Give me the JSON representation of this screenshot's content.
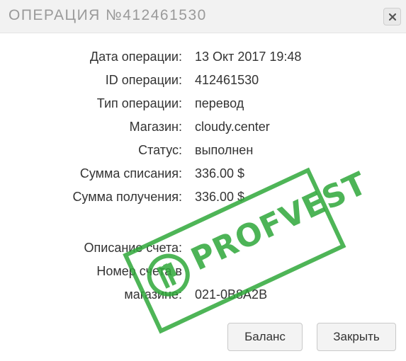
{
  "dialog": {
    "title": "ОПЕРАЦИЯ №412461530",
    "close_icon": "close-x-icon"
  },
  "details": [
    {
      "label": "Дата операции:",
      "value": "13 Окт 2017 19:48"
    },
    {
      "label": "ID операции:",
      "value": "412461530"
    },
    {
      "label": "Тип операции:",
      "value": "перевод"
    },
    {
      "label": "Магазин:",
      "value": "cloudy.center"
    },
    {
      "label": "Статус:",
      "value": "выполнен"
    },
    {
      "label": "Сумма списания:",
      "value": "336.00 $"
    },
    {
      "label": "Сумма получения:",
      "value": "336.00 $"
    }
  ],
  "extra": [
    {
      "label": "Описание счета:",
      "value": ""
    },
    {
      "label": "Номер счета в",
      "value": ""
    },
    {
      "label": "магазине:",
      "value": "021-0B8A2B"
    }
  ],
  "watermark": {
    "text": "PROFVEST",
    "color": "#2fa83a"
  },
  "buttons": {
    "balance": "Баланс",
    "close": "Закрыть"
  }
}
